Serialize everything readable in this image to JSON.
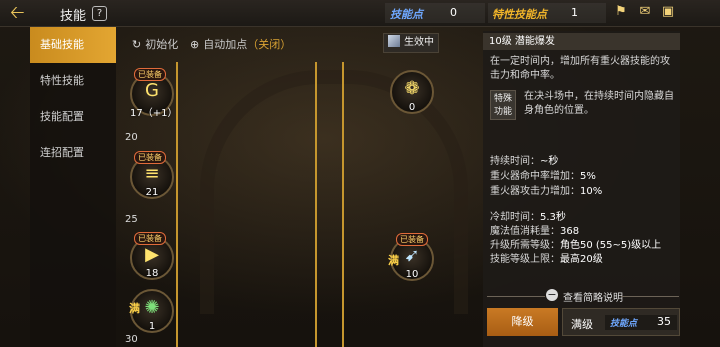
{
  "header": {
    "title": "技能",
    "help": "?",
    "skill_points_label": "技能点",
    "skill_points_value": "0",
    "trait_points_label": "特性技能点",
    "trait_points_value": "1",
    "icons": [
      "back-arrow-icon",
      "help-icon",
      "lamp-icon",
      "mail-icon",
      "chat-icon"
    ]
  },
  "sidebar": {
    "items": [
      {
        "label": "基础技能",
        "active": true
      },
      {
        "label": "特性技能"
      },
      {
        "label": "技能配置"
      },
      {
        "label": "连招配置"
      }
    ]
  },
  "toolbar": {
    "reset_label": "初始化",
    "auto_label": "自动加点",
    "auto_state": "（关闭）",
    "effect_label": "生效中"
  },
  "tree": {
    "levels": [
      "20",
      "25",
      "30"
    ],
    "equipped_label": "已装备",
    "max_label": "满",
    "nodes": [
      {
        "name": "skill-g",
        "count": "17（+1）",
        "equipped": true,
        "sym": "G"
      },
      {
        "name": "skill-rifle",
        "count": "21",
        "equipped": true,
        "sym": "≡"
      },
      {
        "name": "skill-blast",
        "count": "18",
        "equipped": true,
        "sym": "▶"
      },
      {
        "name": "skill-virus",
        "count": "1",
        "max": true,
        "sym": "✺"
      },
      {
        "name": "skill-grenade",
        "count": "0",
        "sym": "❁"
      },
      {
        "name": "skill-heavy",
        "count": "10",
        "equipped": true,
        "max": true,
        "sym": "➹"
      }
    ]
  },
  "detail": {
    "header": "10级 潜能爆发",
    "desc": "在一定时间内，增加所有重火器技能的攻击力和命中率。",
    "special_label": "特殊功能",
    "special_desc": "在决斗场中，在持续时间内隐藏自身角色的位置。",
    "stats1": [
      {
        "k": "持续时间：",
        "v": "~秒"
      },
      {
        "k": "重火器命中率增加：",
        "v": "5%"
      },
      {
        "k": "重火器攻击力增加：",
        "v": "10%"
      }
    ],
    "stats2": [
      {
        "k": "冷却时间：",
        "v": "5.3秒"
      },
      {
        "k": "魔法值消耗量：",
        "v": "368"
      },
      {
        "k": "升级所需等级：",
        "v": "角色50 (55~5)级以上"
      },
      {
        "k": "技能等级上限：",
        "v": "最高20级"
      }
    ],
    "brief_label": "查看简略说明",
    "downgrade_label": "降级",
    "max_label": "满级",
    "sp_label": "技能点",
    "sp_value": "35"
  },
  "colors": {
    "accent": "#e3a632",
    "line": "#c5962e",
    "sp_blue": "#6fa8ff"
  }
}
